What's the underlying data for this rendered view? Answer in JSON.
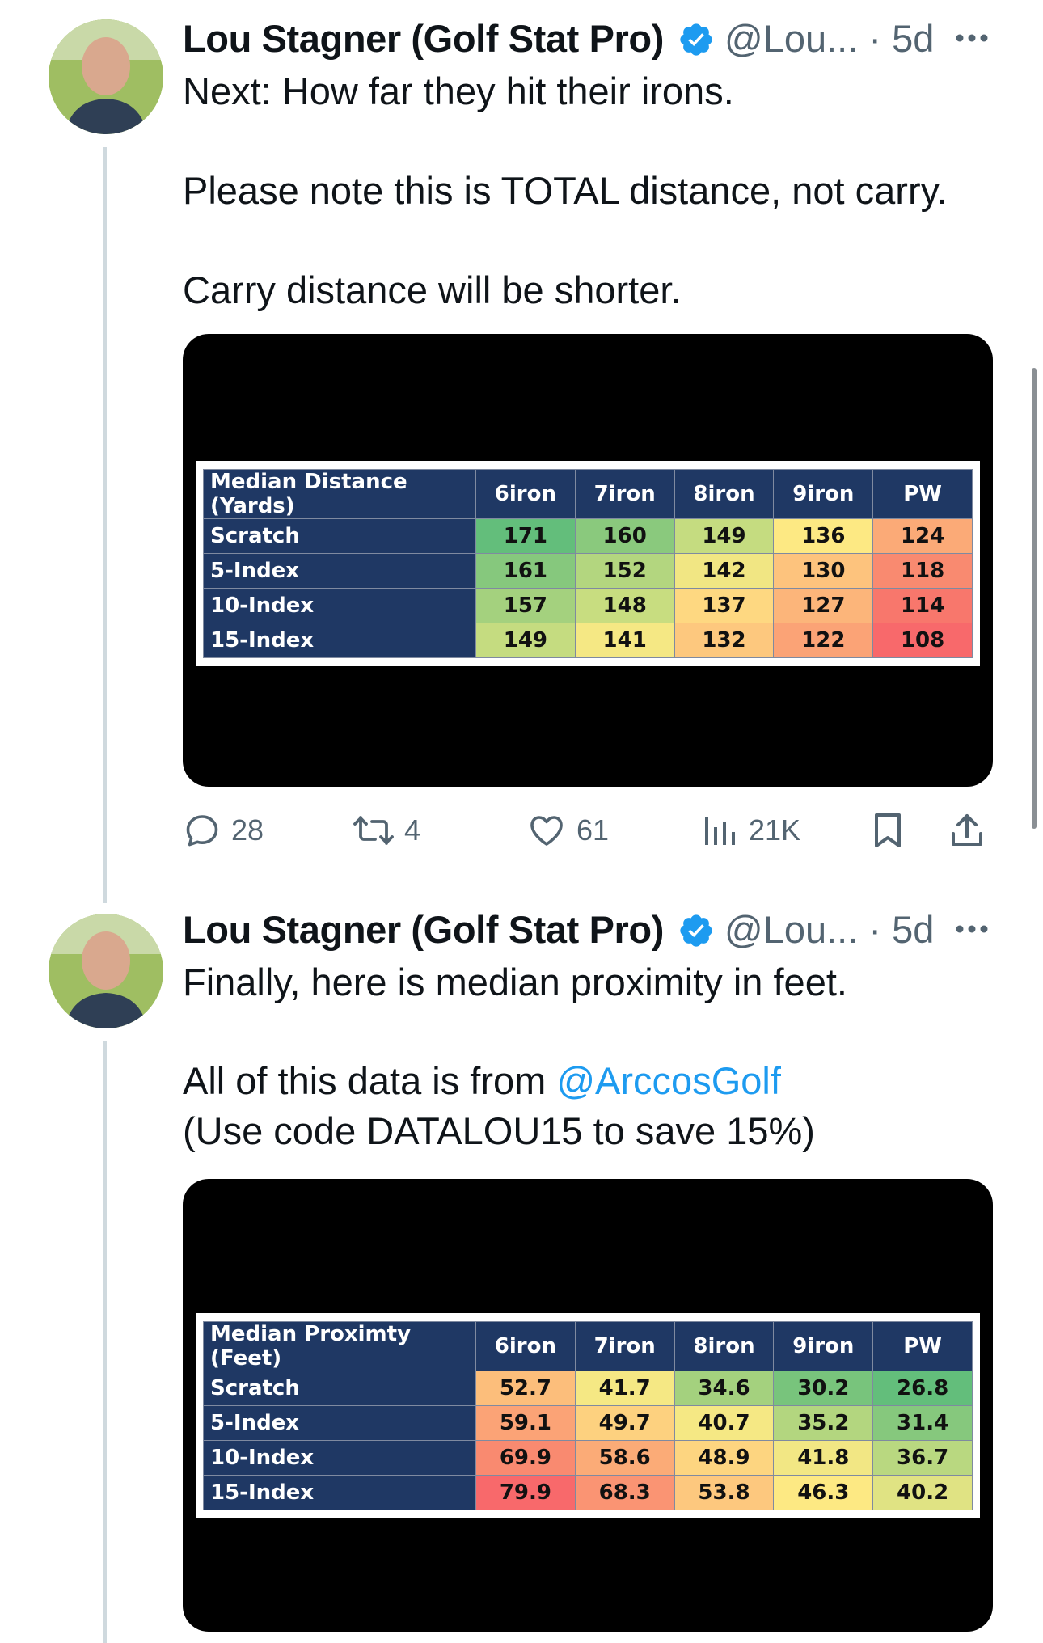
{
  "tweets": [
    {
      "author": "Lou Stagner (Golf Stat Pro)",
      "handle": "@Lou...",
      "time": "· 5d",
      "lines": [
        "Next: How far they hit their irons.",
        "Please note this is TOTAL distance, not carry.",
        "Carry distance will be shorter."
      ],
      "table": {
        "title": "Median Distance (Yards)",
        "columns": [
          "6iron",
          "7iron",
          "8iron",
          "9iron",
          "PW"
        ],
        "rows": [
          {
            "label": "Scratch",
            "values": [
              "171",
              "160",
              "149",
              "136",
              "124"
            ]
          },
          {
            "label": "5-Index",
            "values": [
              "161",
              "152",
              "142",
              "130",
              "118"
            ]
          },
          {
            "label": "10-Index",
            "values": [
              "157",
              "148",
              "137",
              "127",
              "114"
            ]
          },
          {
            "label": "15-Index",
            "values": [
              "149",
              "141",
              "132",
              "122",
              "108"
            ]
          }
        ],
        "colors": [
          [
            "#63be7b",
            "#8ac97d",
            "#c5dc80",
            "#fde983",
            "#fbaa77"
          ],
          [
            "#86c87d",
            "#b3d67f",
            "#f1e683",
            "#fdc37d",
            "#f98a70"
          ],
          [
            "#a4d17e",
            "#c8dd80",
            "#fed881",
            "#fcb57a",
            "#f8776c"
          ],
          [
            "#c5dc80",
            "#f5e884",
            "#fdc87e",
            "#fba376",
            "#f8696b"
          ]
        ]
      },
      "actions": {
        "replies": "28",
        "reposts": "4",
        "likes": "61",
        "views": "21K"
      }
    },
    {
      "author": "Lou Stagner (Golf Stat Pro)",
      "handle": "@Lou...",
      "time": "· 5d",
      "line1": "Finally, here is median proximity in feet.",
      "line2_prefix": "All of this data is from ",
      "line2_link": "@ArccosGolf",
      "line3": "(Use code DATALOU15 to save 15%)",
      "table": {
        "title": "Median Proximty (Feet)",
        "columns": [
          "6iron",
          "7iron",
          "8iron",
          "9iron",
          "PW"
        ],
        "rows": [
          {
            "label": "Scratch",
            "values": [
              "52.7",
              "41.7",
              "34.6",
              "30.2",
              "26.8"
            ]
          },
          {
            "label": "5-Index",
            "values": [
              "59.1",
              "49.7",
              "40.7",
              "35.2",
              "31.4"
            ]
          },
          {
            "label": "10-Index",
            "values": [
              "69.9",
              "58.6",
              "48.9",
              "41.8",
              "36.7"
            ]
          },
          {
            "label": "15-Index",
            "values": [
              "79.9",
              "68.3",
              "53.8",
              "46.3",
              "40.2"
            ]
          }
        ],
        "colors": [
          [
            "#fcbe7b",
            "#f5e884",
            "#a4d17e",
            "#78c47c",
            "#63be7b"
          ],
          [
            "#fba376",
            "#fdd17f",
            "#f5e884",
            "#b3d67f",
            "#86c87d"
          ],
          [
            "#f98a70",
            "#fbab77",
            "#fdd580",
            "#f2e784",
            "#b9d880"
          ],
          [
            "#f8696b",
            "#fa9473",
            "#fdc87e",
            "#fde983",
            "#e0e383"
          ]
        ]
      }
    }
  ]
}
